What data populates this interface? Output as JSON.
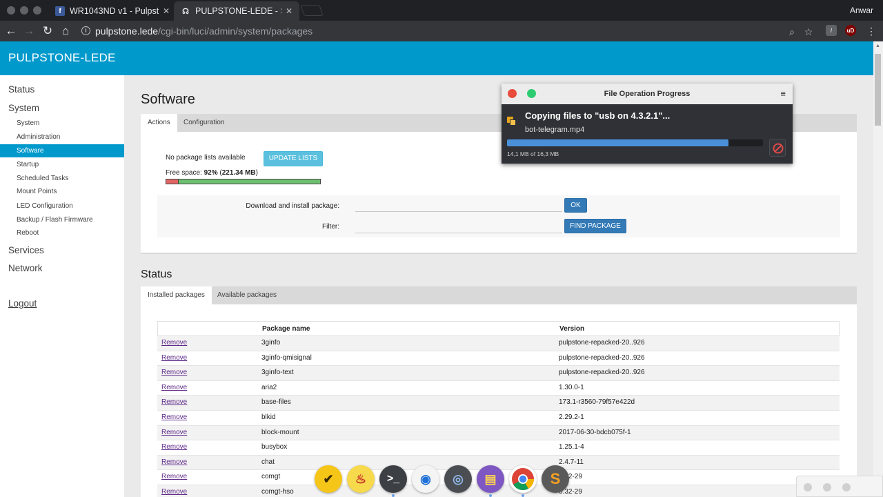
{
  "browser": {
    "tabs": [
      {
        "title": "WR1043ND v1 - Pulpsto",
        "favicon": "facebook-icon",
        "active": false
      },
      {
        "title": "PULPSTONE-LEDE - Sof",
        "favicon": "router-icon",
        "active": true
      }
    ],
    "user": "Anwar",
    "url_host": "pulpstone.lede",
    "url_path": "/cgi-bin/luci/admin/system/packages"
  },
  "brand": "PULPSTONE-LEDE",
  "sidebar": {
    "status": "Status",
    "system": "System",
    "system_items": [
      "System",
      "Administration",
      "Software",
      "Startup",
      "Scheduled Tasks",
      "Mount Points",
      "LED Configuration",
      "Backup / Flash Firmware",
      "Reboot"
    ],
    "active_item": "Software",
    "services": "Services",
    "network": "Network",
    "logout": "Logout"
  },
  "software": {
    "title": "Software",
    "tabs": [
      "Actions",
      "Configuration"
    ],
    "no_lists": "No package lists available",
    "update_button": "UPDATE LISTS",
    "free_space_label": "Free space: ",
    "free_space_pct": "92%",
    "free_space_size": "221.34 MB",
    "free_space_fraction": 0.92,
    "download_label": "Download and install package:",
    "ok_button": "OK",
    "filter_label": "Filter:",
    "find_button": "FIND PACKAGE"
  },
  "status": {
    "title": "Status",
    "tabs": [
      "Installed packages",
      "Available packages"
    ],
    "col_name": "Package name",
    "col_version": "Version",
    "action_label": "Remove",
    "rows": [
      {
        "name": "3ginfo",
        "version": "pulpstone-repacked-20..926"
      },
      {
        "name": "3ginfo-qmisignal",
        "version": "pulpstone-repacked-20..926"
      },
      {
        "name": "3ginfo-text",
        "version": "pulpstone-repacked-20..926"
      },
      {
        "name": "aria2",
        "version": "1.30.0-1"
      },
      {
        "name": "base-files",
        "version": "173.1-r3560-79f57e422d"
      },
      {
        "name": "blkid",
        "version": "2.29.2-1"
      },
      {
        "name": "block-mount",
        "version": "2017-06-30-bdcb075f-1"
      },
      {
        "name": "busybox",
        "version": "1.25.1-4"
      },
      {
        "name": "chat",
        "version": "2.4.7-11"
      },
      {
        "name": "comgt",
        "version": "0.32-29"
      },
      {
        "name": "comgt-hso",
        "version": "0.32-29"
      }
    ]
  },
  "file_op": {
    "window_title": "File Operation Progress",
    "heading": "Copying files to \"usb on 4.3.2.1\"...",
    "file": "bot-telegram.mp4",
    "progress_text": "14,1 MB of 16,3 MB",
    "progress_fraction": 0.865
  },
  "colors": {
    "header": "#0099cc",
    "accent": "#0099cc",
    "progress": "#4a90d9",
    "update_button": "#5bc0de",
    "primary_button": "#337ab7"
  },
  "dock": [
    "task-app-icon",
    "genie-icon",
    "terminal-icon",
    "camera-icon",
    "screen-recorder-icon",
    "file-manager-icon",
    "chrome-icon",
    "sublime-text-icon"
  ]
}
